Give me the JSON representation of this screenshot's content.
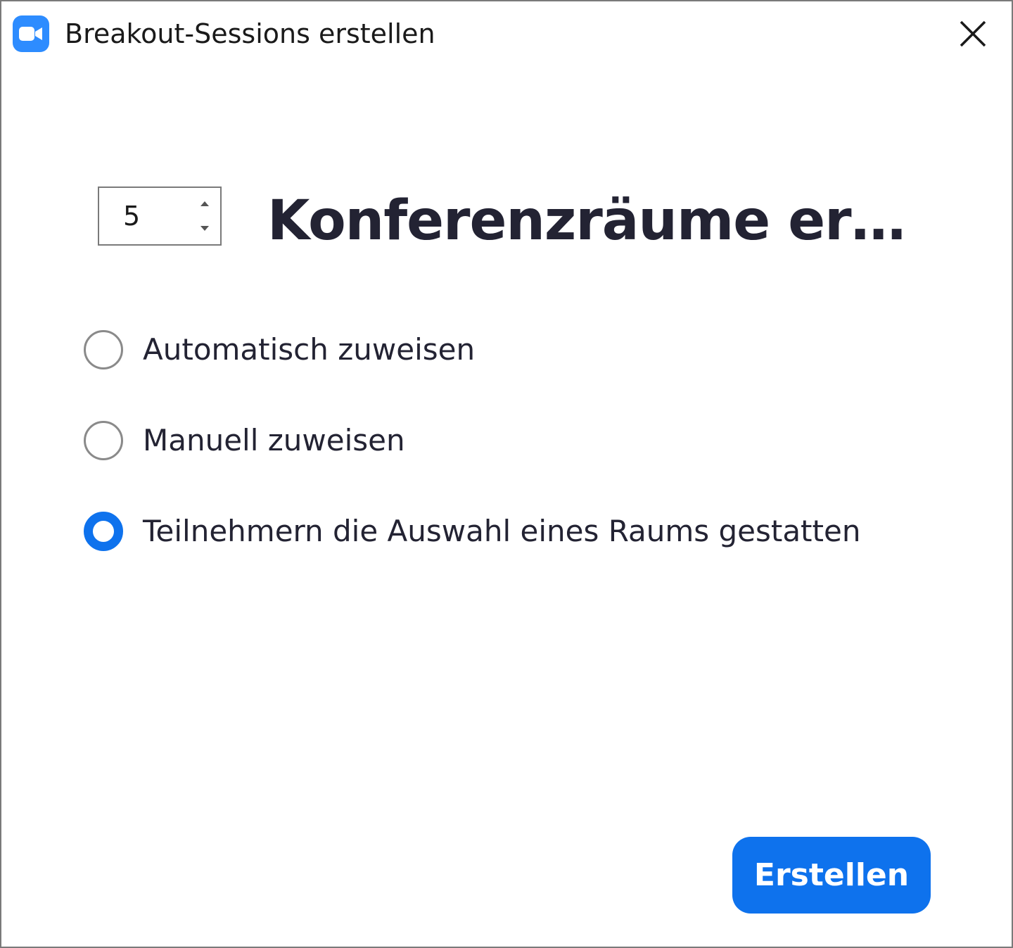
{
  "window": {
    "title": "Breakout-Sessions erstellen",
    "app_icon": "zoom-camera-icon",
    "close_icon": "close-icon"
  },
  "room_count": {
    "value": "5",
    "label": "Konferenzräume erst..."
  },
  "options": [
    {
      "label": "Automatisch zuweisen",
      "checked": false
    },
    {
      "label": "Manuell zuweisen",
      "checked": false
    },
    {
      "label": "Teilnehmern die Auswahl eines Raums gestatten",
      "checked": true
    }
  ],
  "actions": {
    "create_label": "Erstellen"
  },
  "colors": {
    "accent": "#0e72ed",
    "icon_blue": "#2d8cff",
    "text": "#232333"
  }
}
